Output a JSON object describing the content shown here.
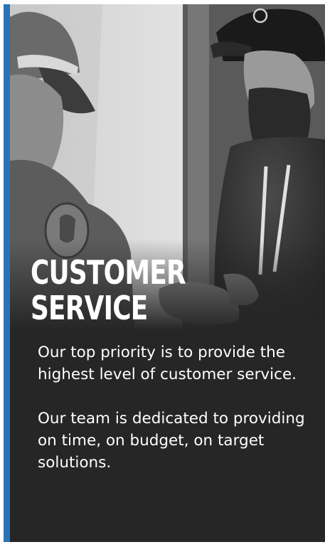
{
  "card": {
    "accent_color": "#2a73b4",
    "background_color": "#262626",
    "photo": {
      "icon": "team-photo",
      "description_style": "black-and-white"
    },
    "heading": {
      "line1": "CUSTOMER",
      "line2": "SERVICE"
    },
    "paragraphs": [
      "Our top priority is to provide the highest level of customer service.",
      "Our team is dedicated to providing on time, on budget, on target solutions."
    ]
  }
}
